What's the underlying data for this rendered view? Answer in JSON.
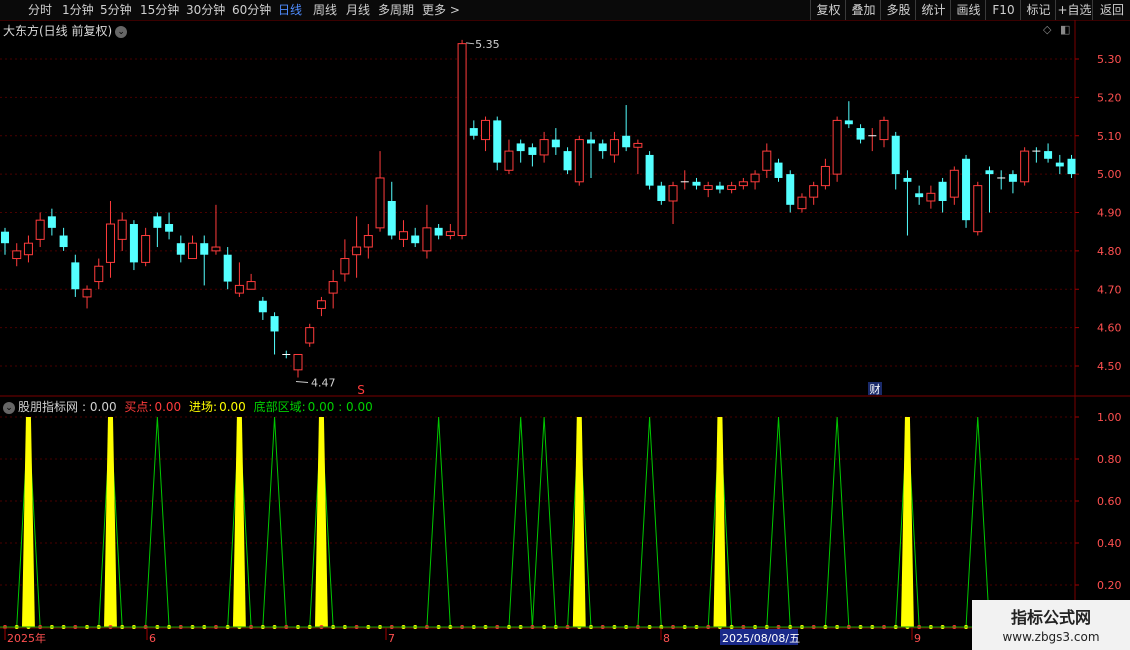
{
  "toolbar": {
    "periods": [
      "分时",
      "1分钟",
      "5分钟",
      "15分钟",
      "30分钟",
      "60分钟",
      "日线",
      "周线",
      "月线",
      "多周期",
      "更多 >"
    ],
    "active_period": "日线",
    "right_buttons": [
      "复权",
      "叠加",
      "多股",
      "统计",
      "画线",
      "F10",
      "标记",
      "+自选",
      "返回"
    ]
  },
  "chart_title": "大东方(日线 前复权)",
  "price_axis": [
    "5.30",
    "5.20",
    "5.10",
    "5.00",
    "4.90",
    "4.80",
    "4.70",
    "4.60",
    "4.50"
  ],
  "indicator_axis": [
    "1.00",
    "0.80",
    "0.60",
    "0.40",
    "0.20"
  ],
  "high_label": "5.35",
  "low_label": "4.47",
  "marker_s": "S",
  "marker_cai": "财",
  "indicator": {
    "name": "股朋指标网",
    "name_value": ": 0.00",
    "buy_label": "买点:",
    "buy_value": "0.00",
    "entry_label": "进场:",
    "entry_value": "0.00",
    "bottom_label": "底部区域:",
    "bottom_value": "0.00 : 0.00"
  },
  "date_axis": {
    "labels": [
      "2025年",
      "6",
      "7",
      "8",
      "9"
    ],
    "highlight": "2025/08/08/五"
  },
  "colors": {
    "up": "#ff3c3c",
    "down": "#54ffff",
    "yellow": "#ffff00",
    "green": "#00c800",
    "grid": "#4a0000"
  },
  "chart_data": {
    "type": "candlestick",
    "price_range": [
      4.45,
      5.38
    ],
    "candles": [
      [
        4.85,
        4.82,
        4.86,
        4.79,
        "d"
      ],
      [
        4.78,
        4.8,
        4.82,
        4.76,
        "u"
      ],
      [
        4.79,
        4.82,
        4.84,
        4.77,
        "u"
      ],
      [
        4.83,
        4.88,
        4.9,
        4.81,
        "u"
      ],
      [
        4.89,
        4.86,
        4.91,
        4.84,
        "d"
      ],
      [
        4.84,
        4.81,
        4.86,
        4.8,
        "d"
      ],
      [
        4.77,
        4.7,
        4.79,
        4.68,
        "d"
      ],
      [
        4.68,
        4.7,
        4.71,
        4.65,
        "u"
      ],
      [
        4.72,
        4.76,
        4.78,
        4.7,
        "u"
      ],
      [
        4.77,
        4.87,
        4.93,
        4.73,
        "u"
      ],
      [
        4.83,
        4.88,
        4.9,
        4.8,
        "u"
      ],
      [
        4.87,
        4.77,
        4.88,
        4.75,
        "d"
      ],
      [
        4.77,
        4.84,
        4.86,
        4.76,
        "u"
      ],
      [
        4.89,
        4.86,
        4.9,
        4.81,
        "d"
      ],
      [
        4.87,
        4.85,
        4.9,
        4.83,
        "d"
      ],
      [
        4.82,
        4.79,
        4.84,
        4.77,
        "d"
      ],
      [
        4.78,
        4.82,
        4.84,
        4.78,
        "u"
      ],
      [
        4.82,
        4.79,
        4.84,
        4.71,
        "d"
      ],
      [
        4.8,
        4.81,
        4.92,
        4.79,
        "u"
      ],
      [
        4.79,
        4.72,
        4.81,
        4.7,
        "d"
      ],
      [
        4.69,
        4.71,
        4.77,
        4.68,
        "u"
      ],
      [
        4.7,
        4.72,
        4.74,
        4.7,
        "u"
      ],
      [
        4.67,
        4.64,
        4.68,
        4.62,
        "d"
      ],
      [
        4.63,
        4.59,
        4.64,
        4.53,
        "d"
      ],
      [
        4.53,
        4.53,
        4.54,
        4.52,
        "d"
      ],
      [
        4.49,
        4.53,
        4.53,
        4.47,
        "u"
      ],
      [
        4.56,
        4.6,
        4.61,
        4.55,
        "u"
      ],
      [
        4.65,
        4.67,
        4.68,
        4.63,
        "u"
      ],
      [
        4.69,
        4.72,
        4.75,
        4.65,
        "u"
      ],
      [
        4.74,
        4.78,
        4.83,
        4.72,
        "u"
      ],
      [
        4.79,
        4.81,
        4.89,
        4.73,
        "u"
      ],
      [
        4.81,
        4.84,
        4.87,
        4.78,
        "u"
      ],
      [
        4.86,
        4.99,
        5.06,
        4.85,
        "u"
      ],
      [
        4.93,
        4.84,
        4.98,
        4.83,
        "d"
      ],
      [
        4.83,
        4.85,
        4.88,
        4.81,
        "u"
      ],
      [
        4.84,
        4.82,
        4.86,
        4.81,
        "d"
      ],
      [
        4.8,
        4.86,
        4.92,
        4.78,
        "u"
      ],
      [
        4.86,
        4.84,
        4.87,
        4.83,
        "d"
      ],
      [
        4.84,
        4.85,
        4.87,
        4.83,
        "u"
      ],
      [
        4.84,
        5.34,
        5.35,
        4.83,
        "u"
      ],
      [
        5.12,
        5.1,
        5.14,
        5.09,
        "d"
      ],
      [
        5.09,
        5.14,
        5.15,
        5.06,
        "u"
      ],
      [
        5.14,
        5.03,
        5.15,
        5.01,
        "d"
      ],
      [
        5.01,
        5.06,
        5.09,
        5.0,
        "u"
      ],
      [
        5.08,
        5.06,
        5.09,
        5.03,
        "d"
      ],
      [
        5.07,
        5.05,
        5.08,
        5.02,
        "d"
      ],
      [
        5.05,
        5.09,
        5.11,
        5.03,
        "u"
      ],
      [
        5.09,
        5.07,
        5.12,
        5.05,
        "d"
      ],
      [
        5.06,
        5.01,
        5.07,
        5.0,
        "d"
      ],
      [
        4.98,
        5.09,
        5.1,
        4.97,
        "u"
      ],
      [
        5.09,
        5.08,
        5.11,
        4.99,
        "d"
      ],
      [
        5.08,
        5.06,
        5.09,
        5.04,
        "d"
      ],
      [
        5.05,
        5.09,
        5.11,
        5.03,
        "u"
      ],
      [
        5.1,
        5.07,
        5.18,
        5.06,
        "d"
      ],
      [
        5.07,
        5.08,
        5.09,
        5.0,
        "u"
      ],
      [
        5.05,
        4.97,
        5.06,
        4.96,
        "d"
      ],
      [
        4.97,
        4.93,
        4.98,
        4.92,
        "d"
      ],
      [
        4.93,
        4.97,
        4.98,
        4.87,
        "u"
      ],
      [
        4.98,
        4.98,
        5.01,
        4.96,
        "u"
      ],
      [
        4.98,
        4.97,
        4.99,
        4.96,
        "d"
      ],
      [
        4.96,
        4.97,
        4.98,
        4.94,
        "u"
      ],
      [
        4.97,
        4.96,
        4.98,
        4.95,
        "d"
      ],
      [
        4.96,
        4.97,
        4.98,
        4.95,
        "u"
      ],
      [
        4.97,
        4.98,
        4.99,
        4.96,
        "u"
      ],
      [
        4.98,
        5.0,
        5.01,
        4.96,
        "u"
      ],
      [
        5.01,
        5.06,
        5.08,
        4.99,
        "u"
      ],
      [
        5.03,
        4.99,
        5.04,
        4.98,
        "d"
      ],
      [
        5.0,
        4.92,
        5.01,
        4.9,
        "d"
      ],
      [
        4.91,
        4.94,
        4.95,
        4.9,
        "u"
      ],
      [
        4.94,
        4.97,
        4.98,
        4.92,
        "u"
      ],
      [
        4.97,
        5.02,
        5.04,
        4.96,
        "u"
      ],
      [
        5.0,
        5.14,
        5.15,
        4.98,
        "u"
      ],
      [
        5.14,
        5.13,
        5.19,
        5.12,
        "d"
      ],
      [
        5.12,
        5.09,
        5.13,
        5.08,
        "d"
      ],
      [
        5.1,
        5.1,
        5.12,
        5.06,
        "u"
      ],
      [
        5.09,
        5.14,
        5.15,
        5.07,
        "u"
      ],
      [
        5.1,
        5.0,
        5.11,
        4.96,
        "d"
      ],
      [
        4.99,
        4.98,
        5.01,
        4.84,
        "d"
      ],
      [
        4.95,
        4.94,
        4.97,
        4.92,
        "d"
      ],
      [
        4.93,
        4.95,
        4.97,
        4.91,
        "u"
      ],
      [
        4.98,
        4.93,
        4.99,
        4.9,
        "d"
      ],
      [
        4.94,
        5.01,
        5.02,
        4.92,
        "u"
      ],
      [
        5.04,
        4.88,
        5.05,
        4.86,
        "d"
      ],
      [
        4.85,
        4.97,
        4.98,
        4.84,
        "u"
      ],
      [
        5.01,
        5.0,
        5.02,
        4.9,
        "d"
      ],
      [
        4.99,
        4.99,
        5.01,
        4.96,
        "d"
      ],
      [
        5.0,
        4.98,
        5.01,
        4.95,
        "d"
      ],
      [
        4.98,
        5.06,
        5.07,
        4.97,
        "u"
      ],
      [
        5.06,
        5.06,
        5.07,
        5.03,
        "d"
      ],
      [
        5.06,
        5.04,
        5.08,
        5.03,
        "d"
      ],
      [
        5.03,
        5.02,
        5.05,
        5.0,
        "d"
      ],
      [
        5.04,
        5.0,
        5.05,
        4.99,
        "d"
      ]
    ],
    "indicator": {
      "range": [
        0,
        1.05
      ],
      "yellow_spikes": [
        2,
        9,
        20,
        27,
        49,
        61,
        77
      ],
      "green_peaks": [
        2,
        9,
        13,
        20,
        23,
        27,
        37,
        44,
        46,
        49,
        55,
        61,
        66,
        71,
        77,
        83
      ]
    }
  }
}
